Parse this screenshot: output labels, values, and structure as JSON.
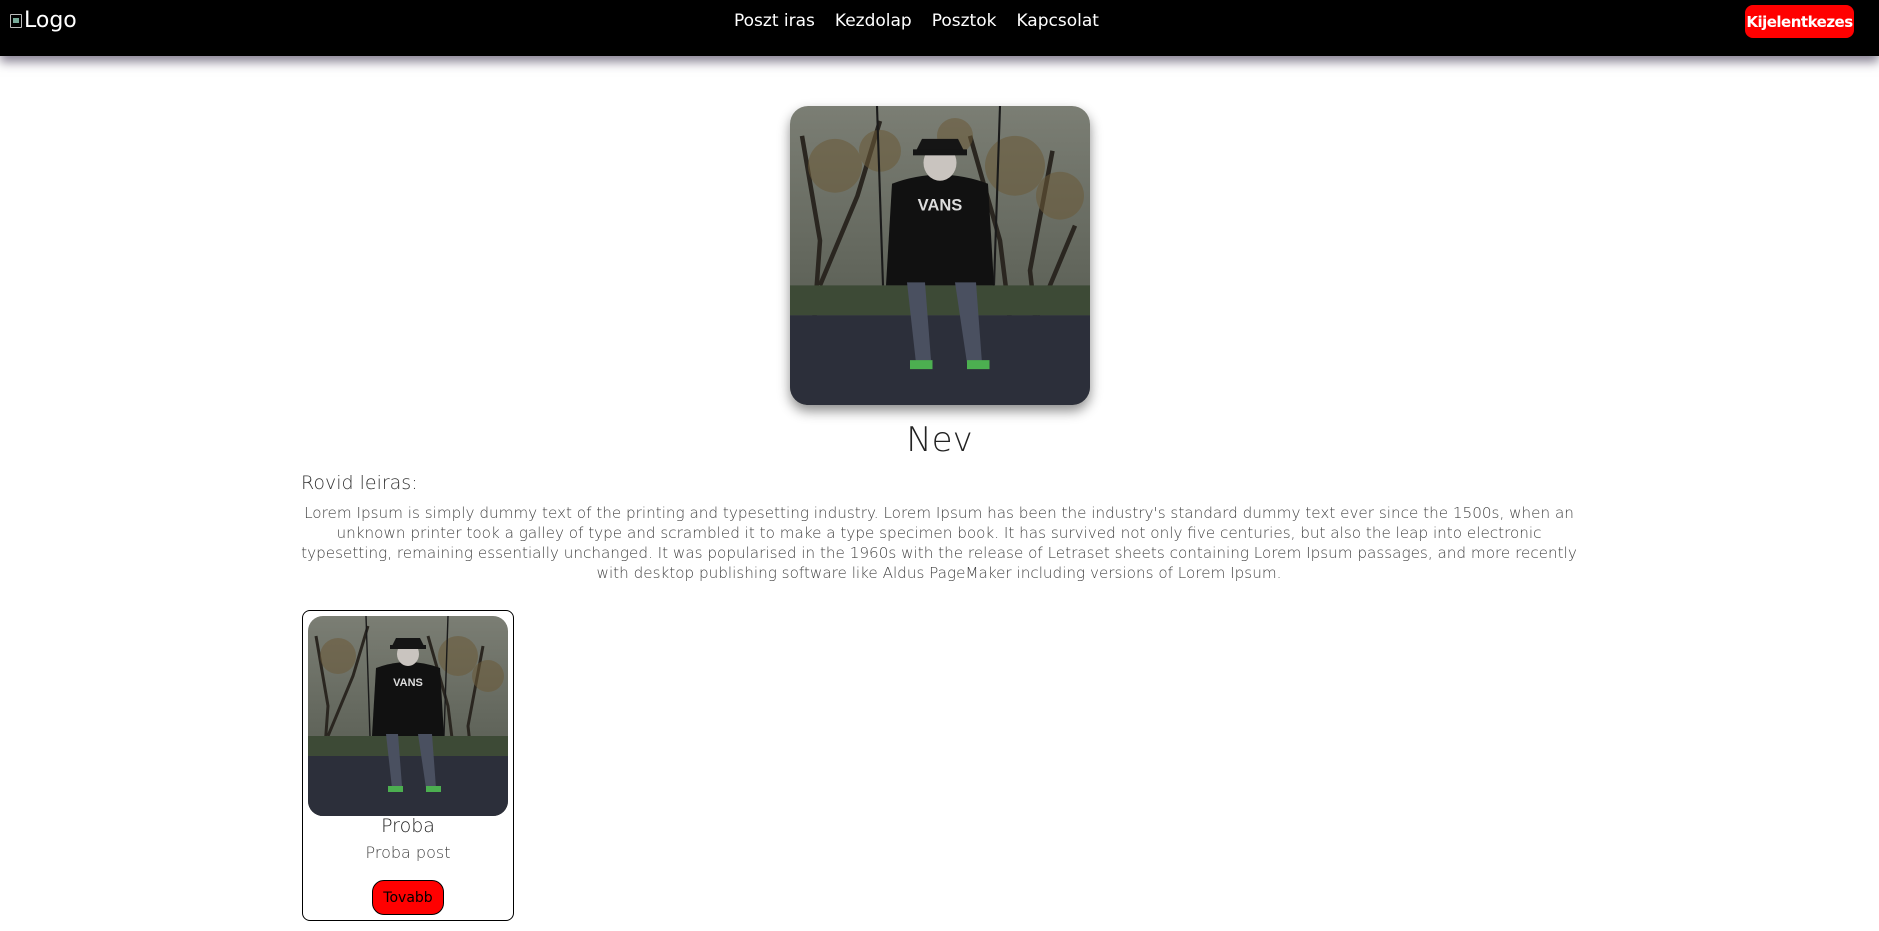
{
  "navbar": {
    "logo_alt": "Logo",
    "links": [
      "Poszt iras",
      "Kezdolap",
      "Posztok",
      "Kapcsolat"
    ],
    "logout_label": "Kijelentkezes"
  },
  "profile": {
    "name": "Nev",
    "bio_heading": "Rovid leiras:",
    "bio_text": "Lorem Ipsum is simply dummy text of the printing and typesetting industry. Lorem Ipsum has been the industry's standard dummy text ever since the 1500s, when an unknown printer took a galley of type and scrambled it to make a type specimen book. It has survived not only five centuries, but also the leap into electronic typesetting, remaining essentially unchanged. It was popularised in the 1960s with the release of Letraset sheets containing Lorem Ipsum passages, and more recently with desktop publishing software like Aldus PageMaker including versions of Lorem Ipsum.",
    "photo_shirt_text": "VANS"
  },
  "posts": [
    {
      "title": "Proba",
      "subtitle": "Proba post",
      "button_label": "Tovabb",
      "photo_shirt_text": "VANS"
    }
  ],
  "colors": {
    "navbar_bg": "#000000",
    "accent_red": "#ff0000"
  }
}
